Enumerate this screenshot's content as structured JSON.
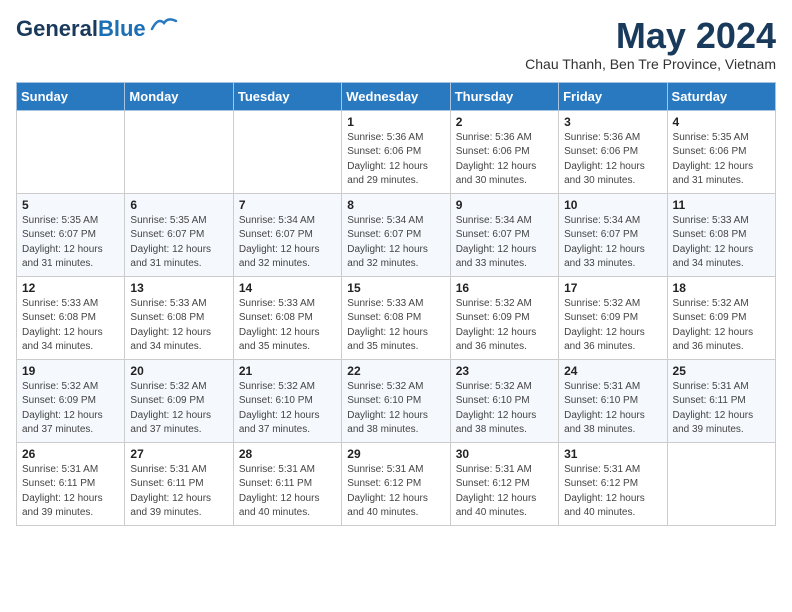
{
  "header": {
    "logo_line1": "General",
    "logo_line2": "Blue",
    "month_year": "May 2024",
    "location": "Chau Thanh, Ben Tre Province, Vietnam"
  },
  "days_of_week": [
    "Sunday",
    "Monday",
    "Tuesday",
    "Wednesday",
    "Thursday",
    "Friday",
    "Saturday"
  ],
  "weeks": [
    [
      {
        "day": "",
        "info": ""
      },
      {
        "day": "",
        "info": ""
      },
      {
        "day": "",
        "info": ""
      },
      {
        "day": "1",
        "info": "Sunrise: 5:36 AM\nSunset: 6:06 PM\nDaylight: 12 hours\nand 29 minutes."
      },
      {
        "day": "2",
        "info": "Sunrise: 5:36 AM\nSunset: 6:06 PM\nDaylight: 12 hours\nand 30 minutes."
      },
      {
        "day": "3",
        "info": "Sunrise: 5:36 AM\nSunset: 6:06 PM\nDaylight: 12 hours\nand 30 minutes."
      },
      {
        "day": "4",
        "info": "Sunrise: 5:35 AM\nSunset: 6:06 PM\nDaylight: 12 hours\nand 31 minutes."
      }
    ],
    [
      {
        "day": "5",
        "info": "Sunrise: 5:35 AM\nSunset: 6:07 PM\nDaylight: 12 hours\nand 31 minutes."
      },
      {
        "day": "6",
        "info": "Sunrise: 5:35 AM\nSunset: 6:07 PM\nDaylight: 12 hours\nand 31 minutes."
      },
      {
        "day": "7",
        "info": "Sunrise: 5:34 AM\nSunset: 6:07 PM\nDaylight: 12 hours\nand 32 minutes."
      },
      {
        "day": "8",
        "info": "Sunrise: 5:34 AM\nSunset: 6:07 PM\nDaylight: 12 hours\nand 32 minutes."
      },
      {
        "day": "9",
        "info": "Sunrise: 5:34 AM\nSunset: 6:07 PM\nDaylight: 12 hours\nand 33 minutes."
      },
      {
        "day": "10",
        "info": "Sunrise: 5:34 AM\nSunset: 6:07 PM\nDaylight: 12 hours\nand 33 minutes."
      },
      {
        "day": "11",
        "info": "Sunrise: 5:33 AM\nSunset: 6:08 PM\nDaylight: 12 hours\nand 34 minutes."
      }
    ],
    [
      {
        "day": "12",
        "info": "Sunrise: 5:33 AM\nSunset: 6:08 PM\nDaylight: 12 hours\nand 34 minutes."
      },
      {
        "day": "13",
        "info": "Sunrise: 5:33 AM\nSunset: 6:08 PM\nDaylight: 12 hours\nand 34 minutes."
      },
      {
        "day": "14",
        "info": "Sunrise: 5:33 AM\nSunset: 6:08 PM\nDaylight: 12 hours\nand 35 minutes."
      },
      {
        "day": "15",
        "info": "Sunrise: 5:33 AM\nSunset: 6:08 PM\nDaylight: 12 hours\nand 35 minutes."
      },
      {
        "day": "16",
        "info": "Sunrise: 5:32 AM\nSunset: 6:09 PM\nDaylight: 12 hours\nand 36 minutes."
      },
      {
        "day": "17",
        "info": "Sunrise: 5:32 AM\nSunset: 6:09 PM\nDaylight: 12 hours\nand 36 minutes."
      },
      {
        "day": "18",
        "info": "Sunrise: 5:32 AM\nSunset: 6:09 PM\nDaylight: 12 hours\nand 36 minutes."
      }
    ],
    [
      {
        "day": "19",
        "info": "Sunrise: 5:32 AM\nSunset: 6:09 PM\nDaylight: 12 hours\nand 37 minutes."
      },
      {
        "day": "20",
        "info": "Sunrise: 5:32 AM\nSunset: 6:09 PM\nDaylight: 12 hours\nand 37 minutes."
      },
      {
        "day": "21",
        "info": "Sunrise: 5:32 AM\nSunset: 6:10 PM\nDaylight: 12 hours\nand 37 minutes."
      },
      {
        "day": "22",
        "info": "Sunrise: 5:32 AM\nSunset: 6:10 PM\nDaylight: 12 hours\nand 38 minutes."
      },
      {
        "day": "23",
        "info": "Sunrise: 5:32 AM\nSunset: 6:10 PM\nDaylight: 12 hours\nand 38 minutes."
      },
      {
        "day": "24",
        "info": "Sunrise: 5:31 AM\nSunset: 6:10 PM\nDaylight: 12 hours\nand 38 minutes."
      },
      {
        "day": "25",
        "info": "Sunrise: 5:31 AM\nSunset: 6:11 PM\nDaylight: 12 hours\nand 39 minutes."
      }
    ],
    [
      {
        "day": "26",
        "info": "Sunrise: 5:31 AM\nSunset: 6:11 PM\nDaylight: 12 hours\nand 39 minutes."
      },
      {
        "day": "27",
        "info": "Sunrise: 5:31 AM\nSunset: 6:11 PM\nDaylight: 12 hours\nand 39 minutes."
      },
      {
        "day": "28",
        "info": "Sunrise: 5:31 AM\nSunset: 6:11 PM\nDaylight: 12 hours\nand 40 minutes."
      },
      {
        "day": "29",
        "info": "Sunrise: 5:31 AM\nSunset: 6:12 PM\nDaylight: 12 hours\nand 40 minutes."
      },
      {
        "day": "30",
        "info": "Sunrise: 5:31 AM\nSunset: 6:12 PM\nDaylight: 12 hours\nand 40 minutes."
      },
      {
        "day": "31",
        "info": "Sunrise: 5:31 AM\nSunset: 6:12 PM\nDaylight: 12 hours\nand 40 minutes."
      },
      {
        "day": "",
        "info": ""
      }
    ]
  ]
}
